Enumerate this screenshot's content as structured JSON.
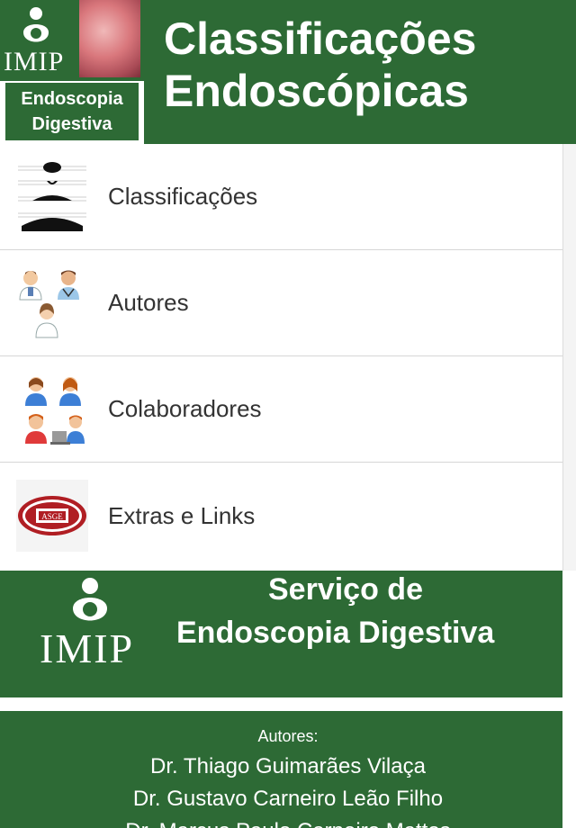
{
  "header": {
    "logo_text": "IMIP",
    "logo_subtitle_1": "Endoscopia",
    "logo_subtitle_2": "Digestiva",
    "title_line1": "Classificações",
    "title_line2": "Endoscópicas"
  },
  "menu": {
    "items": [
      {
        "label": "Classificações",
        "icon": "classification-chart-icon"
      },
      {
        "label": "Autores",
        "icon": "doctors-icon"
      },
      {
        "label": "Colaboradores",
        "icon": "collaborators-icon"
      },
      {
        "label": "Extras e Links",
        "icon": "asge-logo-icon"
      }
    ]
  },
  "footer": {
    "logo_text": "IMIP",
    "service_line1": "Serviço de",
    "service_line2": "Endoscopia Digestiva",
    "authors_title": "Autores:",
    "authors": [
      "Dr. Thiago Guimarães Vilaça",
      "Dr. Gustavo Carneiro Leão Filho",
      "Dr. Marcus Paulo Carneiro Mattos"
    ]
  },
  "colors": {
    "brand_green": "#2d6a35",
    "text": "#333333",
    "divider": "#d6d6d6"
  }
}
